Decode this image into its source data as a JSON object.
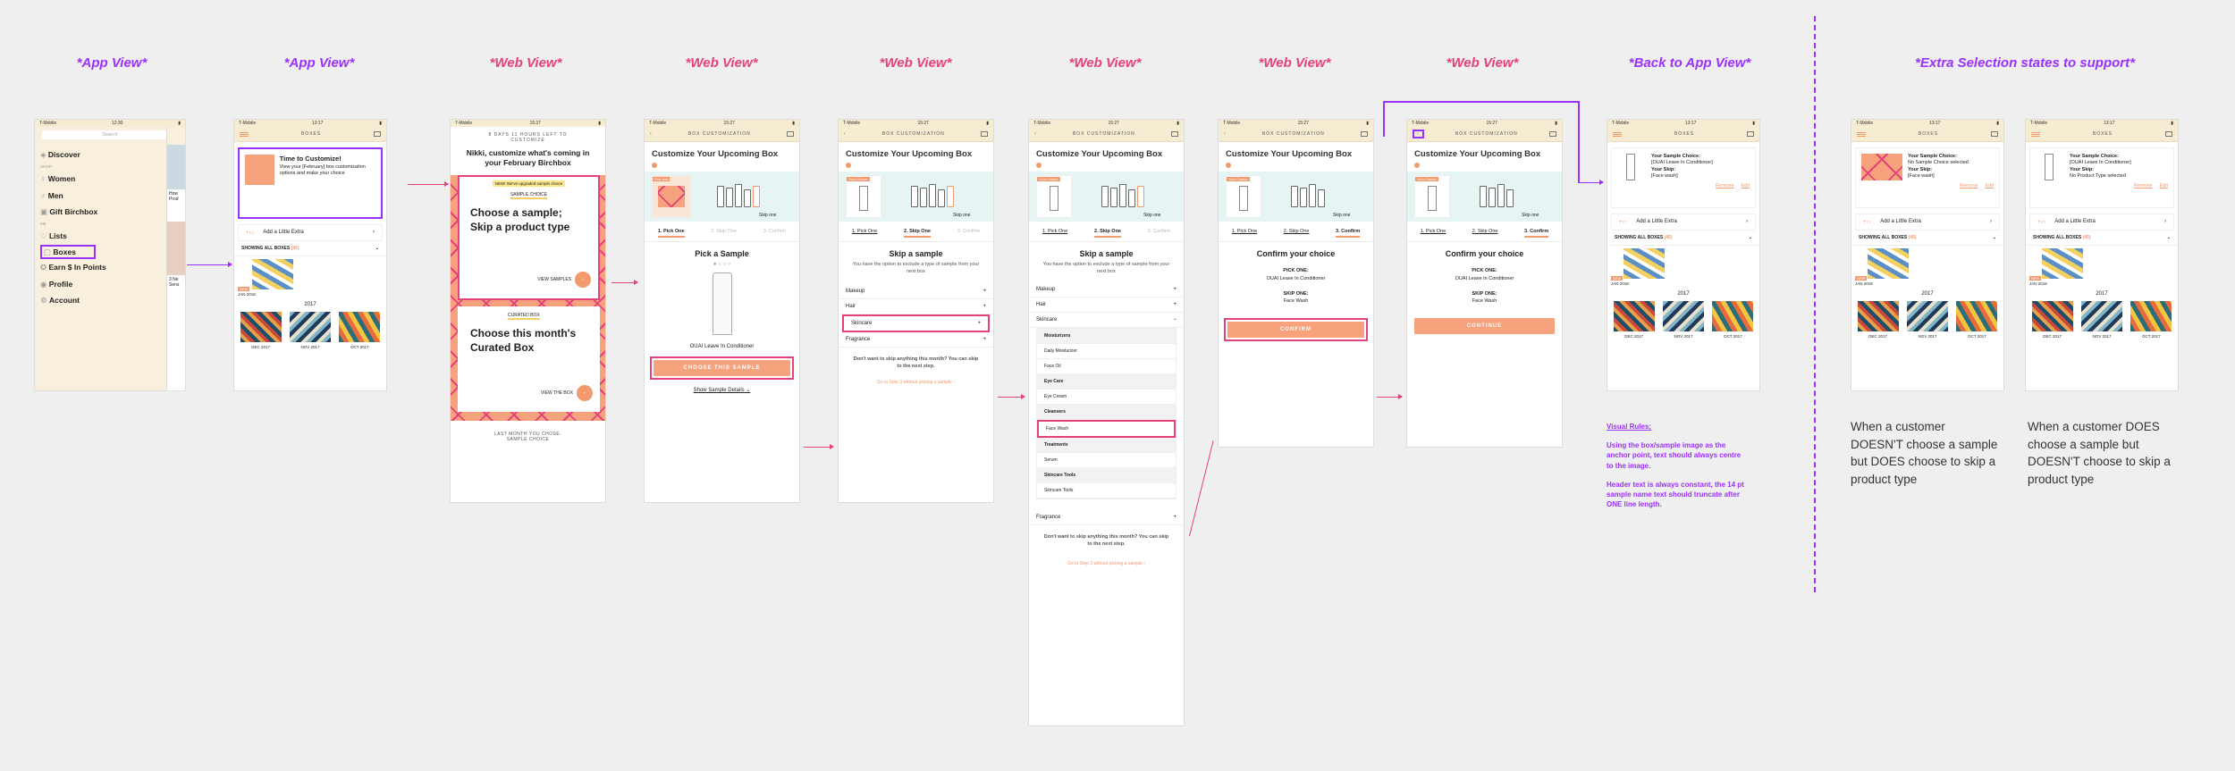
{
  "labels": {
    "app_view": "*App View*",
    "web_view": "*Web View*",
    "back_to_app": "*Back to App View*",
    "extra_states": "*Extra Selection states to support*"
  },
  "status": {
    "carrier": "T-Mobile",
    "time1": "12:30",
    "time2": "13:17",
    "time3": "15:27"
  },
  "nav_titles": {
    "boxes": "BOXES",
    "customization": "BOX CUSTOMIZATION"
  },
  "menu": {
    "search_placeholder": "Search",
    "items": [
      "Discover",
      "Women",
      "Men",
      "Gift Birchbox",
      "Lists",
      "Boxes",
      "Earn $ In Points",
      "Profile",
      "Account"
    ],
    "shop_label": "SHOP",
    "me_label": "ME",
    "side_text": [
      "How",
      "Prod",
      "3 Ne",
      "Sens"
    ]
  },
  "boxes": {
    "time_title": "Time to Customize!",
    "time_body": "View your [February] box customization options and make your choice",
    "add_extra": "Add a Little Extra",
    "showing_all": "SHOWING ALL BOXES",
    "showing_count": "(45)",
    "new_badge": "NEW",
    "jan": "JAN 2018",
    "year": "2017",
    "months": [
      "DEC 2017",
      "NOV 2017",
      "OCT 2017"
    ]
  },
  "web1": {
    "countdown": "8 DAYS 11 HOURS LEFT TO CUSTOMIZE",
    "heading": "Nikki, customize what's coming in your February Birchbox",
    "upgrade_tag": "NEW! We've upgraded sample choice",
    "sample_choice_tag": "SAMPLE CHOICE",
    "card1_title": "Choose a sample; Skip a product type",
    "view_samples": "VIEW SAMPLES",
    "curated_tag": "CURATED BOX",
    "card2_title": "Choose this month's Curated Box",
    "view_box": "VIEW THE BOX",
    "last_month": "LAST MONTH YOU CHOSE: SAMPLE CHOICE"
  },
  "custom": {
    "title": "Customize Your Upcoming Box",
    "pick_one_tag": "Pick one",
    "your_choice_tag": "Your Choice",
    "skip_one": "Skip one",
    "step1": "1. Pick One",
    "step2": "2. Skip One",
    "step3": "3. Confirm",
    "pick_sample": "Pick a Sample",
    "product_name": "OUAI Leave In Conditioner",
    "choose_btn": "CHOOSE THIS SAMPLE",
    "show_details": "Show Sample Details",
    "skip_title": "Skip a sample",
    "skip_sub": "You have the option to exclude a type of sample from your next box",
    "categories": [
      "Makeup",
      "Hair",
      "Skincare",
      "Fragrance"
    ],
    "no_skip": "Don't want to skip anything this month? You can skip to the next step.",
    "go_step3": "Go to Step 3 without picking a sample",
    "sub_items": [
      {
        "label": "Moisturizers",
        "header": true
      },
      {
        "label": "Daily Moisturizer",
        "header": false
      },
      {
        "label": "Face Oil",
        "header": false
      },
      {
        "label": "Eye Care",
        "header": true
      },
      {
        "label": "Eye Cream",
        "header": false
      },
      {
        "label": "Cleansers",
        "header": true
      },
      {
        "label": "Face Wash",
        "header": false
      },
      {
        "label": "Treatments",
        "header": true
      },
      {
        "label": "Serum",
        "header": false
      },
      {
        "label": "Skincare Tools",
        "header": true
      },
      {
        "label": "Skincare Tools",
        "header": false
      }
    ],
    "confirm_title": "Confirm your choice",
    "pick_one_label": "PICK ONE:",
    "skip_one_label": "SKIP ONE:",
    "skip_value": "Face Wash",
    "confirm_btn": "CONFIRM",
    "continue_btn": "CONTINUE"
  },
  "back_app": {
    "your_sample": "Your Sample Choice:",
    "sample_value": "[OUAI Leave In Conditioner]",
    "your_skip": "Your Skip:",
    "skip_value": "[Face wash]",
    "remove": "Remove",
    "edit": "Edit"
  },
  "extra": {
    "no_sample": "No Sample Choice selected",
    "no_product_type": "No Product Type selected",
    "desc1": "When a customer DOESN'T choose a sample but DOES choose to skip a product type",
    "desc2": "When a customer DOES choose a sample but DOESN'T choose to skip a product type"
  },
  "rules": {
    "title": "Visual Rules;",
    "p1": "Using the box/sample image as the anchor point, text should always centre to the image.",
    "p2": "Header text is always constant, the 14 pt sample name text should truncate after ONE line length."
  }
}
